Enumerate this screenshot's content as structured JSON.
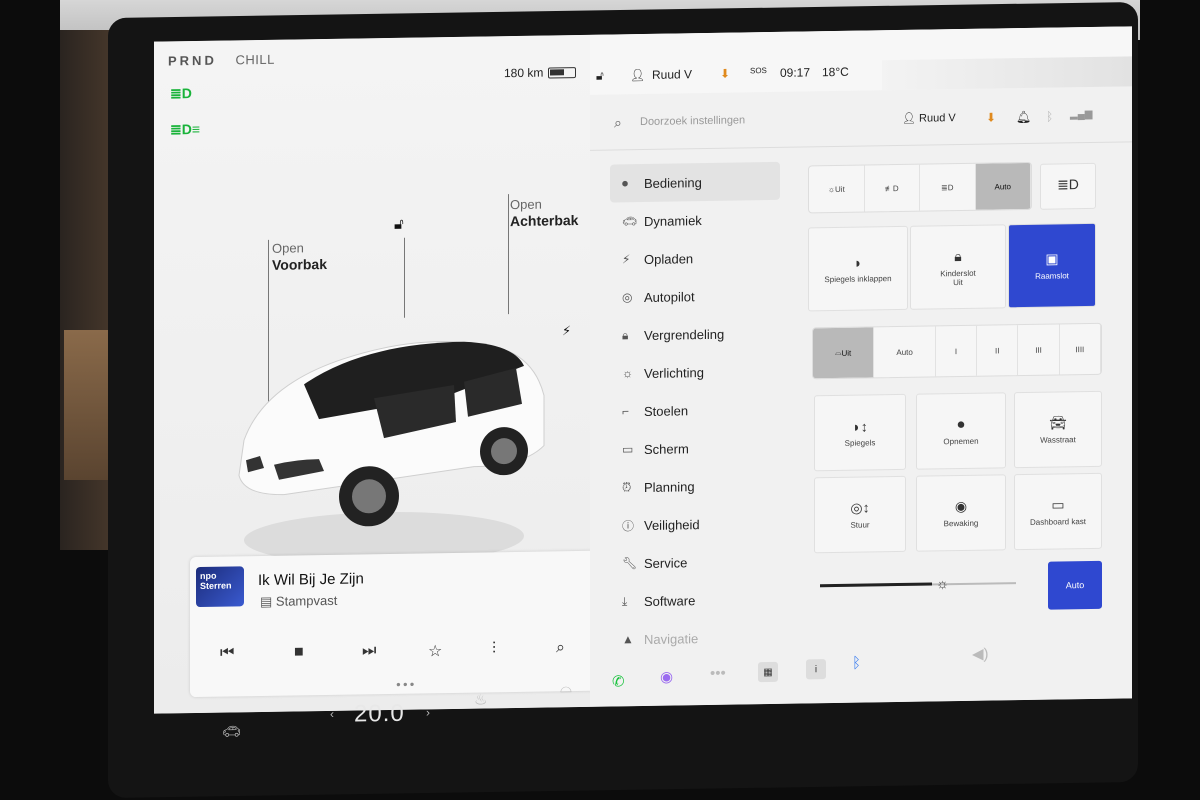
{
  "drive": {
    "gears": "PRND",
    "mode": "CHILL",
    "range": "180 km"
  },
  "car_labels": {
    "frunk_top": "Open",
    "frunk_bottom": "Voorbak",
    "trunk_top": "Open",
    "trunk_bottom": "Achterbak"
  },
  "media": {
    "station": "npo Sterren",
    "title": "Ik Wil Bij Je Zijn",
    "artist": "Stampvast"
  },
  "status": {
    "user": "Ruud V",
    "sos": "SOS",
    "time": "09:17",
    "temp": "18°C"
  },
  "search": {
    "placeholder": "Doorzoek instellingen",
    "user": "Ruud V"
  },
  "menu": [
    {
      "label": "Bediening",
      "icon": "toggle-icon"
    },
    {
      "label": "Dynamiek",
      "icon": "car-icon"
    },
    {
      "label": "Opladen",
      "icon": "bolt-icon"
    },
    {
      "label": "Autopilot",
      "icon": "steering-wheel-icon"
    },
    {
      "label": "Vergrendeling",
      "icon": "lock-icon"
    },
    {
      "label": "Verlichting",
      "icon": "sun-icon"
    },
    {
      "label": "Stoelen",
      "icon": "seat-icon"
    },
    {
      "label": "Scherm",
      "icon": "display-icon"
    },
    {
      "label": "Planning",
      "icon": "alarm-icon"
    },
    {
      "label": "Veiligheid",
      "icon": "info-icon"
    },
    {
      "label": "Service",
      "icon": "wrench-icon"
    },
    {
      "label": "Software",
      "icon": "download-icon"
    },
    {
      "label": "Navigatie",
      "icon": "navigation-icon"
    }
  ],
  "lights": {
    "off": "Uit",
    "auto": "Auto"
  },
  "tiles": {
    "mirrors_fold": "Spiegels inklappen",
    "child_lock": "Kinderslot",
    "child_lock_state": "Uit",
    "window_lock": "Raamslot"
  },
  "wipers": {
    "off": "Uit",
    "auto": "Auto",
    "speeds": [
      "I",
      "II",
      "III",
      "IIII"
    ]
  },
  "shortcuts": {
    "mirrors": "Spiegels",
    "record": "Opnemen",
    "carwash": "Wasstraat",
    "wheel": "Stuur",
    "sentry": "Bewaking",
    "dashcam": "Dashboard kast"
  },
  "brightness": {
    "auto": "Auto",
    "level": 0.57
  },
  "dock": {
    "temp": "20.0"
  },
  "colors": {
    "accent_blue": "#2f48d0",
    "status_green": "#19b33a"
  }
}
